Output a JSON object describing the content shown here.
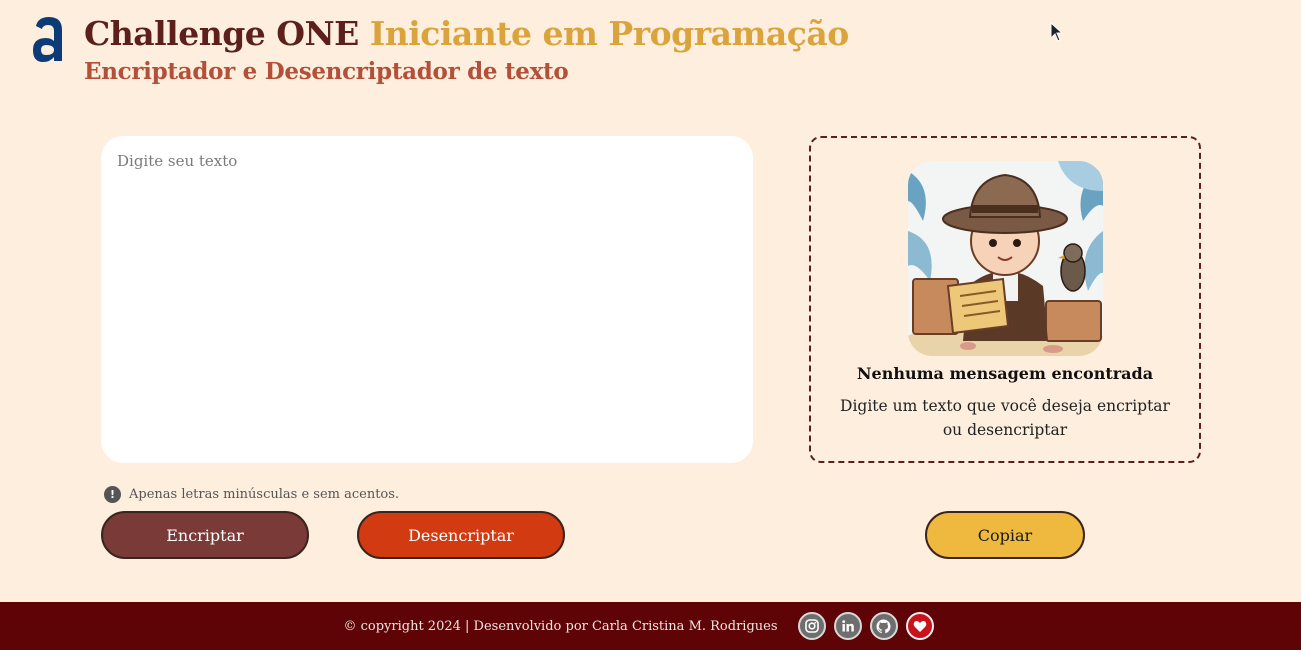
{
  "header": {
    "title_part1": "Challenge ONE",
    "title_part2": "Iniciante em Programação",
    "subtitle": "Encriptador e Desencriptador de texto"
  },
  "input": {
    "placeholder": "Digite seu texto"
  },
  "output": {
    "empty_title": "Nenhuma mensagem encontrada",
    "empty_description": "Digite um texto que você deseja encriptar ou desencriptar"
  },
  "hint": {
    "text": "Apenas letras minúsculas e sem acentos."
  },
  "buttons": {
    "encrypt": "Encriptar",
    "decrypt": "Desencriptar",
    "copy": "Copiar"
  },
  "footer": {
    "text": "© copyright 2024 | Desenvolvido por Carla Cristina M. Rodrigues",
    "social_icons": [
      "instagram-icon",
      "linkedin-icon",
      "github-icon",
      "heart-icon"
    ]
  },
  "colors": {
    "background": "#fdeedd",
    "title_dark": "#5c1f1a",
    "title_gold": "#dba33b",
    "subtitle": "#b3503a",
    "encrypt_button": "#7a3b38",
    "decrypt_button": "#d23a12",
    "copy_button": "#efb940",
    "footer": "#5e0306",
    "logo": "#0d3b78"
  }
}
